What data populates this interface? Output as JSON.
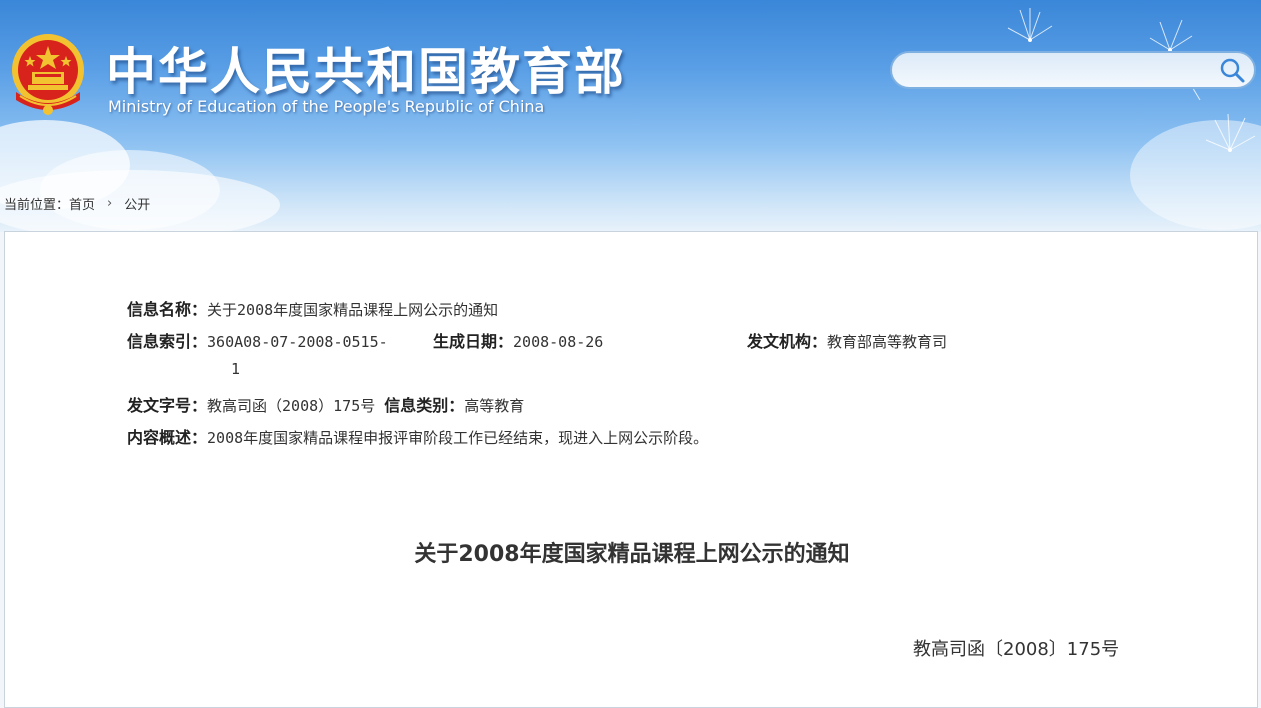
{
  "header": {
    "title": "中华人民共和国教育部",
    "subtitle": "Ministry of Education of the People's Republic of China",
    "search": {
      "value": "",
      "placeholder": ""
    }
  },
  "breadcrumb": {
    "prefix": "当前位置：",
    "items": [
      "首页",
      "公开"
    ],
    "separator": "›"
  },
  "meta": {
    "name_label": "信息名称：",
    "name_value": "关于2008年度国家精品课程上网公示的通知",
    "index_label": "信息索引：",
    "index_value_line1": "360A08-07-2008-0515-",
    "index_value_line2": "1",
    "date_label": "生成日期：",
    "date_value": "2008-08-26",
    "org_label": "发文机构：",
    "org_value": "教育部高等教育司",
    "docno_label": "发文字号：",
    "docno_value": "教高司函（2008）175号",
    "category_label": "信息类别：",
    "category_value": "高等教育",
    "summary_label": "内容概述：",
    "summary_value": "2008年度国家精品课程申报评审阶段工作已经结束，现进入上网公示阶段。"
  },
  "document": {
    "title": "关于2008年度国家精品课程上网公示的通知",
    "number": "教高司函〔2008〕175号"
  },
  "colors": {
    "header_blue": "#3a86d8",
    "emblem_red": "#d8231c",
    "emblem_gold": "#f2c230",
    "text": "#333333"
  }
}
